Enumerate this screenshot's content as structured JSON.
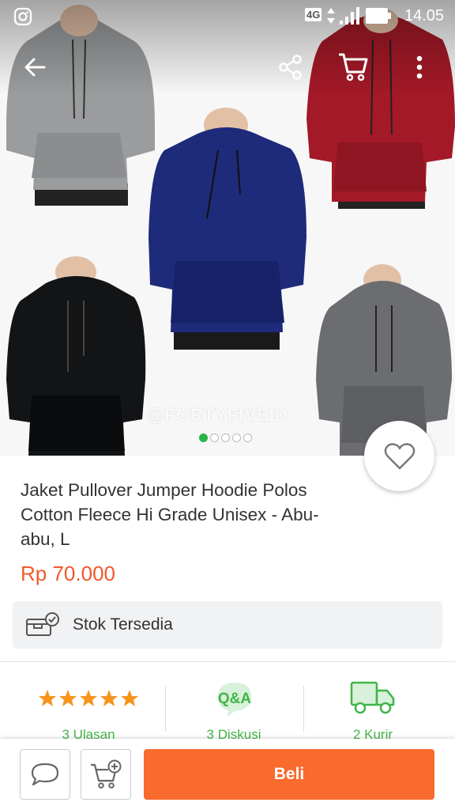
{
  "status_bar": {
    "time": "14.05",
    "network": "4G"
  },
  "gallery": {
    "watermark": "@FORTYFIVEID",
    "images_total": 5,
    "active_index": 1,
    "hoodie_colors": [
      "#9a9c9e",
      "#a31927",
      "#1e2a7a",
      "#121416",
      "#6b6d70"
    ]
  },
  "product": {
    "title": "Jaket Pullover Jumper Hoodie Polos Cotton Fleece Hi Grade Unisex - Abu-abu, L",
    "price": "Rp 70.000",
    "stock_label": "Stok Tersedia",
    "rating_stars": 5
  },
  "stats": {
    "reviews_label": "3 Ulasan",
    "qa_badge": "Q&A",
    "discussions_label": "3 Diskusi",
    "couriers_label": "2 Kurir"
  },
  "actions": {
    "buy_label": "Beli"
  },
  "colors": {
    "accent_orange": "#f96a2d",
    "price_orange": "#f0592b",
    "green": "#42b549",
    "star": "#f7941d"
  }
}
